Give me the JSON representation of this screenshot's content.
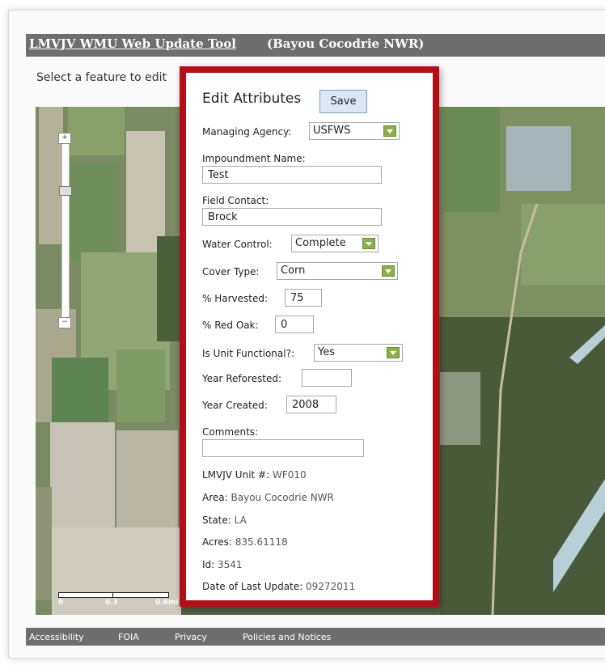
{
  "app": {
    "title_link": "LMVJV WMU Web Update Tool",
    "title_sub": "(Bayou Cocodrie NWR)",
    "prompt": "Select a feature to edit"
  },
  "map": {
    "zoom_in": "+",
    "zoom_out": "−",
    "scale": {
      "t0": "0",
      "t1": "0.3",
      "t2": "0.6mi"
    }
  },
  "footer": {
    "links": [
      "Accessibility",
      "FOIA",
      "Privacy",
      "Policies and Notices"
    ]
  },
  "editor": {
    "heading": "Edit Attributes",
    "save_label": "Save",
    "managing_agency": {
      "label": "Managing Agency:",
      "value": "USFWS"
    },
    "impoundment_name": {
      "label": "Impoundment Name:",
      "value": "Test"
    },
    "field_contact": {
      "label": "Field Contact:",
      "value": "Brock"
    },
    "water_control": {
      "label": "Water Control:",
      "value": "Complete"
    },
    "cover_type": {
      "label": "Cover Type:",
      "value": "Corn"
    },
    "pct_harvested": {
      "label": "% Harvested:",
      "value": "75"
    },
    "pct_red_oak": {
      "label": "% Red Oak:",
      "value": "0"
    },
    "unit_functional": {
      "label": "Is Unit Functional?:",
      "value": "Yes"
    },
    "year_reforested": {
      "label": "Year Reforested:",
      "value": ""
    },
    "year_created": {
      "label": "Year Created:",
      "value": "2008"
    },
    "comments": {
      "label": "Comments:",
      "value": ""
    },
    "unit_no": {
      "label": "LMVJV Unit #:",
      "value": "WF010"
    },
    "area": {
      "label": "Area:",
      "value": "Bayou Cocodrie NWR"
    },
    "state": {
      "label": "State:",
      "value": "LA"
    },
    "acres": {
      "label": "Acres:",
      "value": "835.61118"
    },
    "id": {
      "label": "Id:",
      "value": "3541"
    },
    "last_update": {
      "label": "Date of Last Update:",
      "value": "09272011"
    }
  }
}
